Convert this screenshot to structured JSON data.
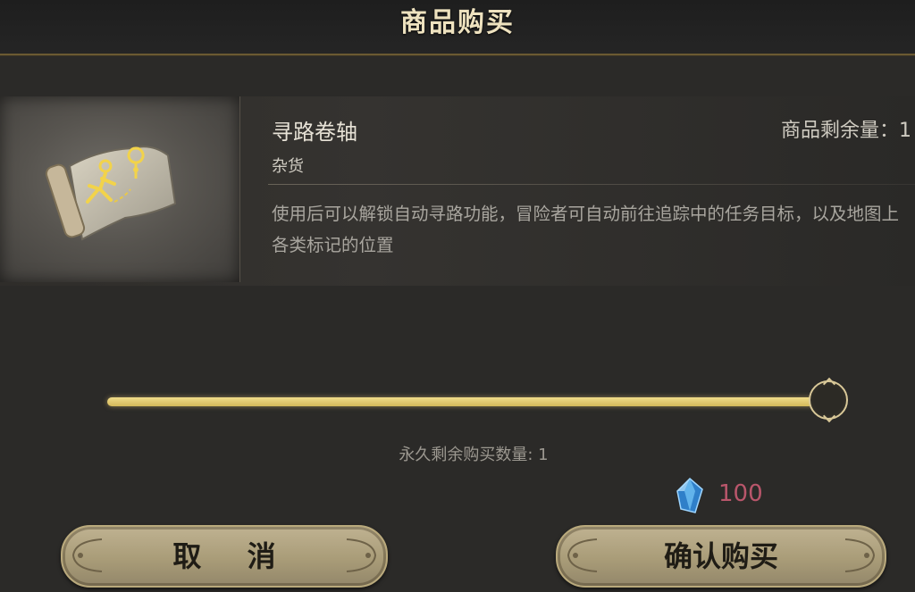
{
  "dialog": {
    "title": "商品购买"
  },
  "item": {
    "name": "寻路卷轴",
    "category": "杂货",
    "stock_label": "商品剩余量：1",
    "description": "使用后可以解锁自动寻路功能，冒险者可自动前往追踪中的任务目标，以及地图上各类标记的位置",
    "icon": "map-scroll-icon"
  },
  "purchase": {
    "slider_value": 1,
    "slider_max": 1,
    "remaining_text": "永久剩余购买数量: 1",
    "price": "100",
    "currency_icon": "blue-crystal-icon",
    "price_color": "#b9566b"
  },
  "buttons": {
    "cancel_label": "取 消",
    "confirm_label": "确认购买"
  },
  "colors": {
    "accent_gold": "#e8d27a",
    "button_face": "#b0a37f"
  }
}
